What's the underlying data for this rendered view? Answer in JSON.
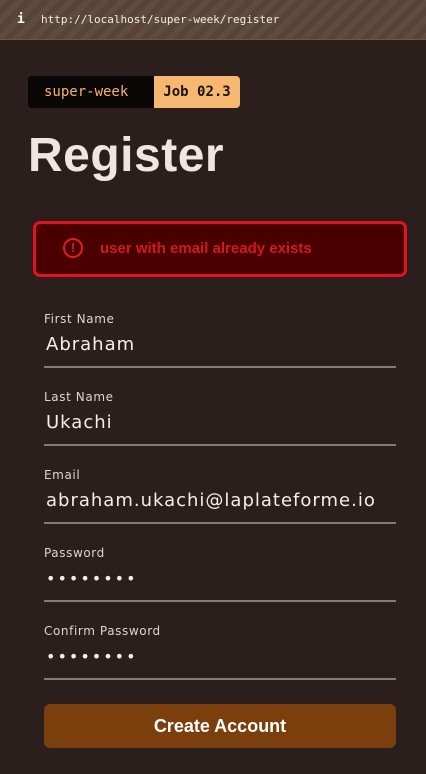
{
  "browser": {
    "info_glyph": "i",
    "url": "http://localhost/super-week/register"
  },
  "tag": {
    "brand": "super-week",
    "job": "Job 02.3"
  },
  "page": {
    "title": "Register"
  },
  "alert": {
    "icon": "alert-circle-icon",
    "icon_glyph": "!",
    "message": "user with email already exists",
    "color": "#e4121e"
  },
  "form": {
    "first_name": {
      "label": "First Name",
      "value": "Abraham"
    },
    "last_name": {
      "label": "Last Name",
      "value": "Ukachi"
    },
    "email": {
      "label": "Email",
      "value": "abraham.ukachi@laplateforme.io"
    },
    "password": {
      "label": "Password",
      "value": "abcdefgh"
    },
    "confirm_password": {
      "label": "Confirm Password",
      "value": "abcdefgh"
    },
    "submit_label": "Create Account"
  },
  "colors": {
    "background": "#2a1f1c",
    "accent": "#f6b870",
    "button": "#7a3f0c",
    "error": "#e4121e"
  }
}
